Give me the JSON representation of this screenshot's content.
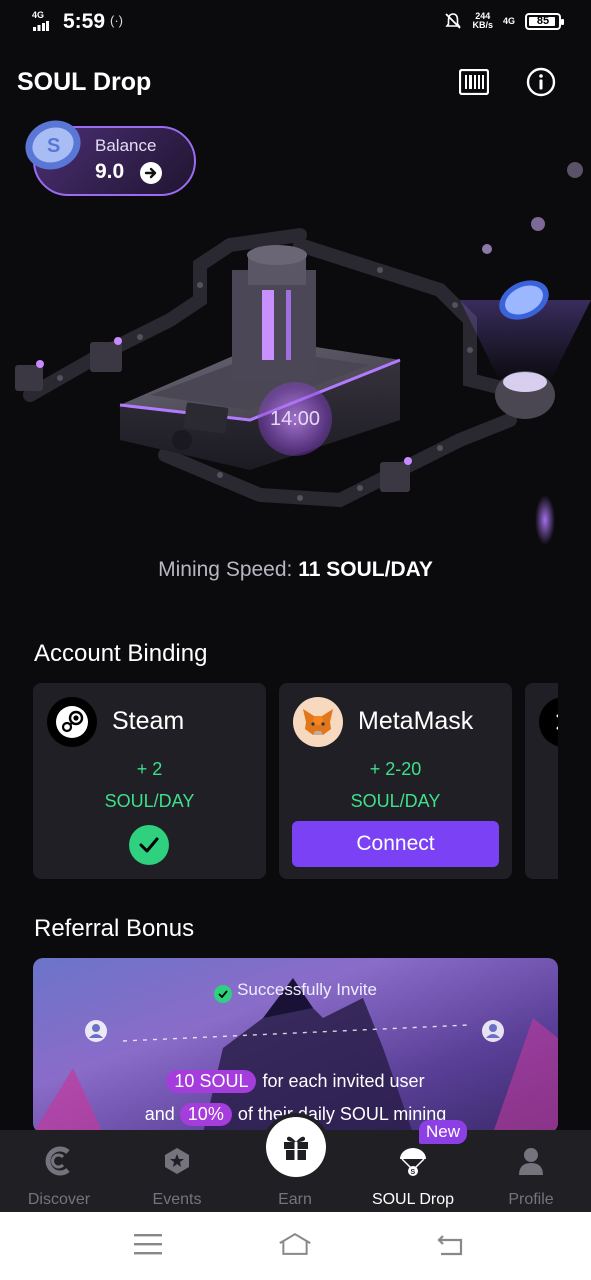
{
  "status_bar": {
    "network": "4G",
    "time": "5:59",
    "net_speed_value": "244",
    "net_speed_unit": "KB/s",
    "network_right": "4G",
    "battery": "85"
  },
  "header": {
    "title": "SOUL Drop",
    "icons": [
      "barcode-icon",
      "info-icon"
    ]
  },
  "balance": {
    "label": "Balance",
    "value": "9.0"
  },
  "mining": {
    "timer": "14:00",
    "label": "Mining Speed:",
    "value": "11 SOUL/DAY"
  },
  "account_binding": {
    "title": "Account Binding",
    "cards": [
      {
        "name": "Steam",
        "reward": "+ 2",
        "unit": "SOUL/DAY",
        "status": "connected"
      },
      {
        "name": "MetaMask",
        "reward": "+ 2-20",
        "unit": "SOUL/DAY",
        "button": "Connect"
      }
    ]
  },
  "referral": {
    "title": "Referral Bonus",
    "success_text": "Successfully Invite",
    "line1_pill": "10 SOUL",
    "line1_text": "for each invited user",
    "line2_prefix": "and",
    "line2_pill": "10%",
    "line2_text": "of their daily SOUL mining"
  },
  "bottom_nav": {
    "items": [
      {
        "label": "Discover",
        "icon": "discover-icon"
      },
      {
        "label": "Events",
        "icon": "events-icon"
      },
      {
        "label": "Earn",
        "icon": "gift-icon"
      },
      {
        "label": "SOUL Drop",
        "icon": "parachute-icon",
        "active": true
      },
      {
        "label": "Profile",
        "icon": "profile-icon"
      }
    ],
    "badge": "New"
  },
  "colors": {
    "background": "#0b0a0d",
    "accent_purple": "#7b42f5",
    "reward_green": "#3ee08a",
    "card_bg": "#1f1f25"
  }
}
